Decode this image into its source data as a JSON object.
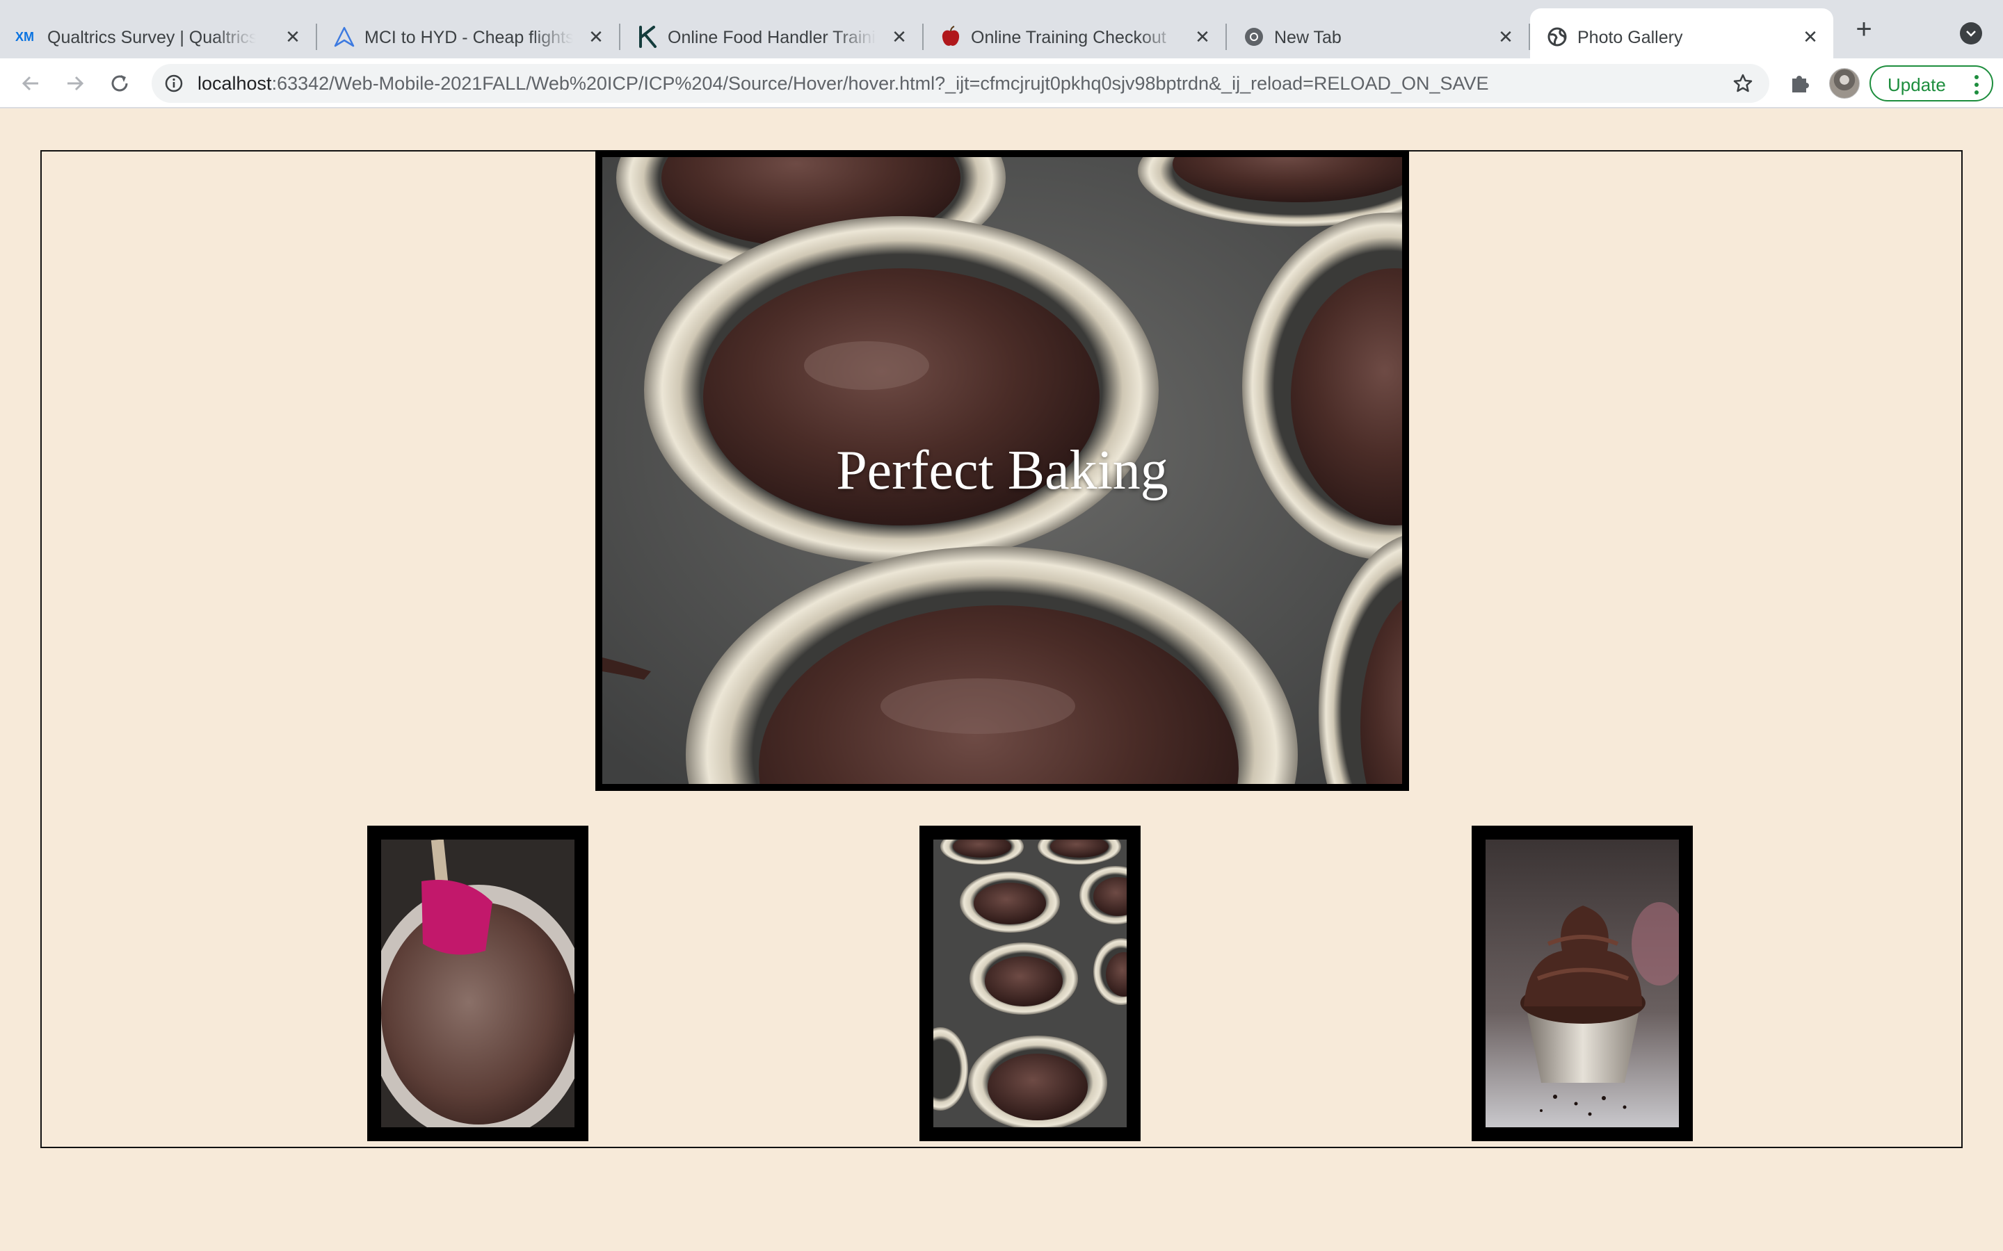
{
  "tabs": [
    {
      "title": "Qualtrics Survey | Qualtrics",
      "icon": "xm-logo-icon",
      "active": false
    },
    {
      "title": "MCI to HYD - Cheap flights",
      "icon": "flight-logo-icon",
      "active": false
    },
    {
      "title": "Online Food Handler Training",
      "icon": "k-logo-icon",
      "active": false
    },
    {
      "title": "Online Training Checkout",
      "icon": "apple-icon",
      "active": false
    },
    {
      "title": "New Tab",
      "icon": "chrome-icon",
      "active": false
    },
    {
      "title": "Photo Gallery",
      "icon": "globe-icon",
      "active": true
    }
  ],
  "address_bar": {
    "host": "localhost",
    "path": ":63342/Web-Mobile-2021FALL/Web%20ICP/ICP%204/Source/Hover/hover.html?_ijt=cfmcjrujt0pkhq0sjv98bptrdn&_ij_reload=RELOAD_ON_SAVE"
  },
  "toolbar": {
    "update_label": "Update"
  },
  "gallery": {
    "hero_caption": "Perfect Baking",
    "thumbnails": [
      {
        "subject": "chocolate batter bowl with spatula"
      },
      {
        "subject": "muffin tin with cupcake liners"
      },
      {
        "subject": "chocolate frosted cupcake"
      }
    ]
  },
  "colors": {
    "page_background": "#f7ead9",
    "frame": "#000000",
    "update_accent": "#1e8e3e"
  }
}
